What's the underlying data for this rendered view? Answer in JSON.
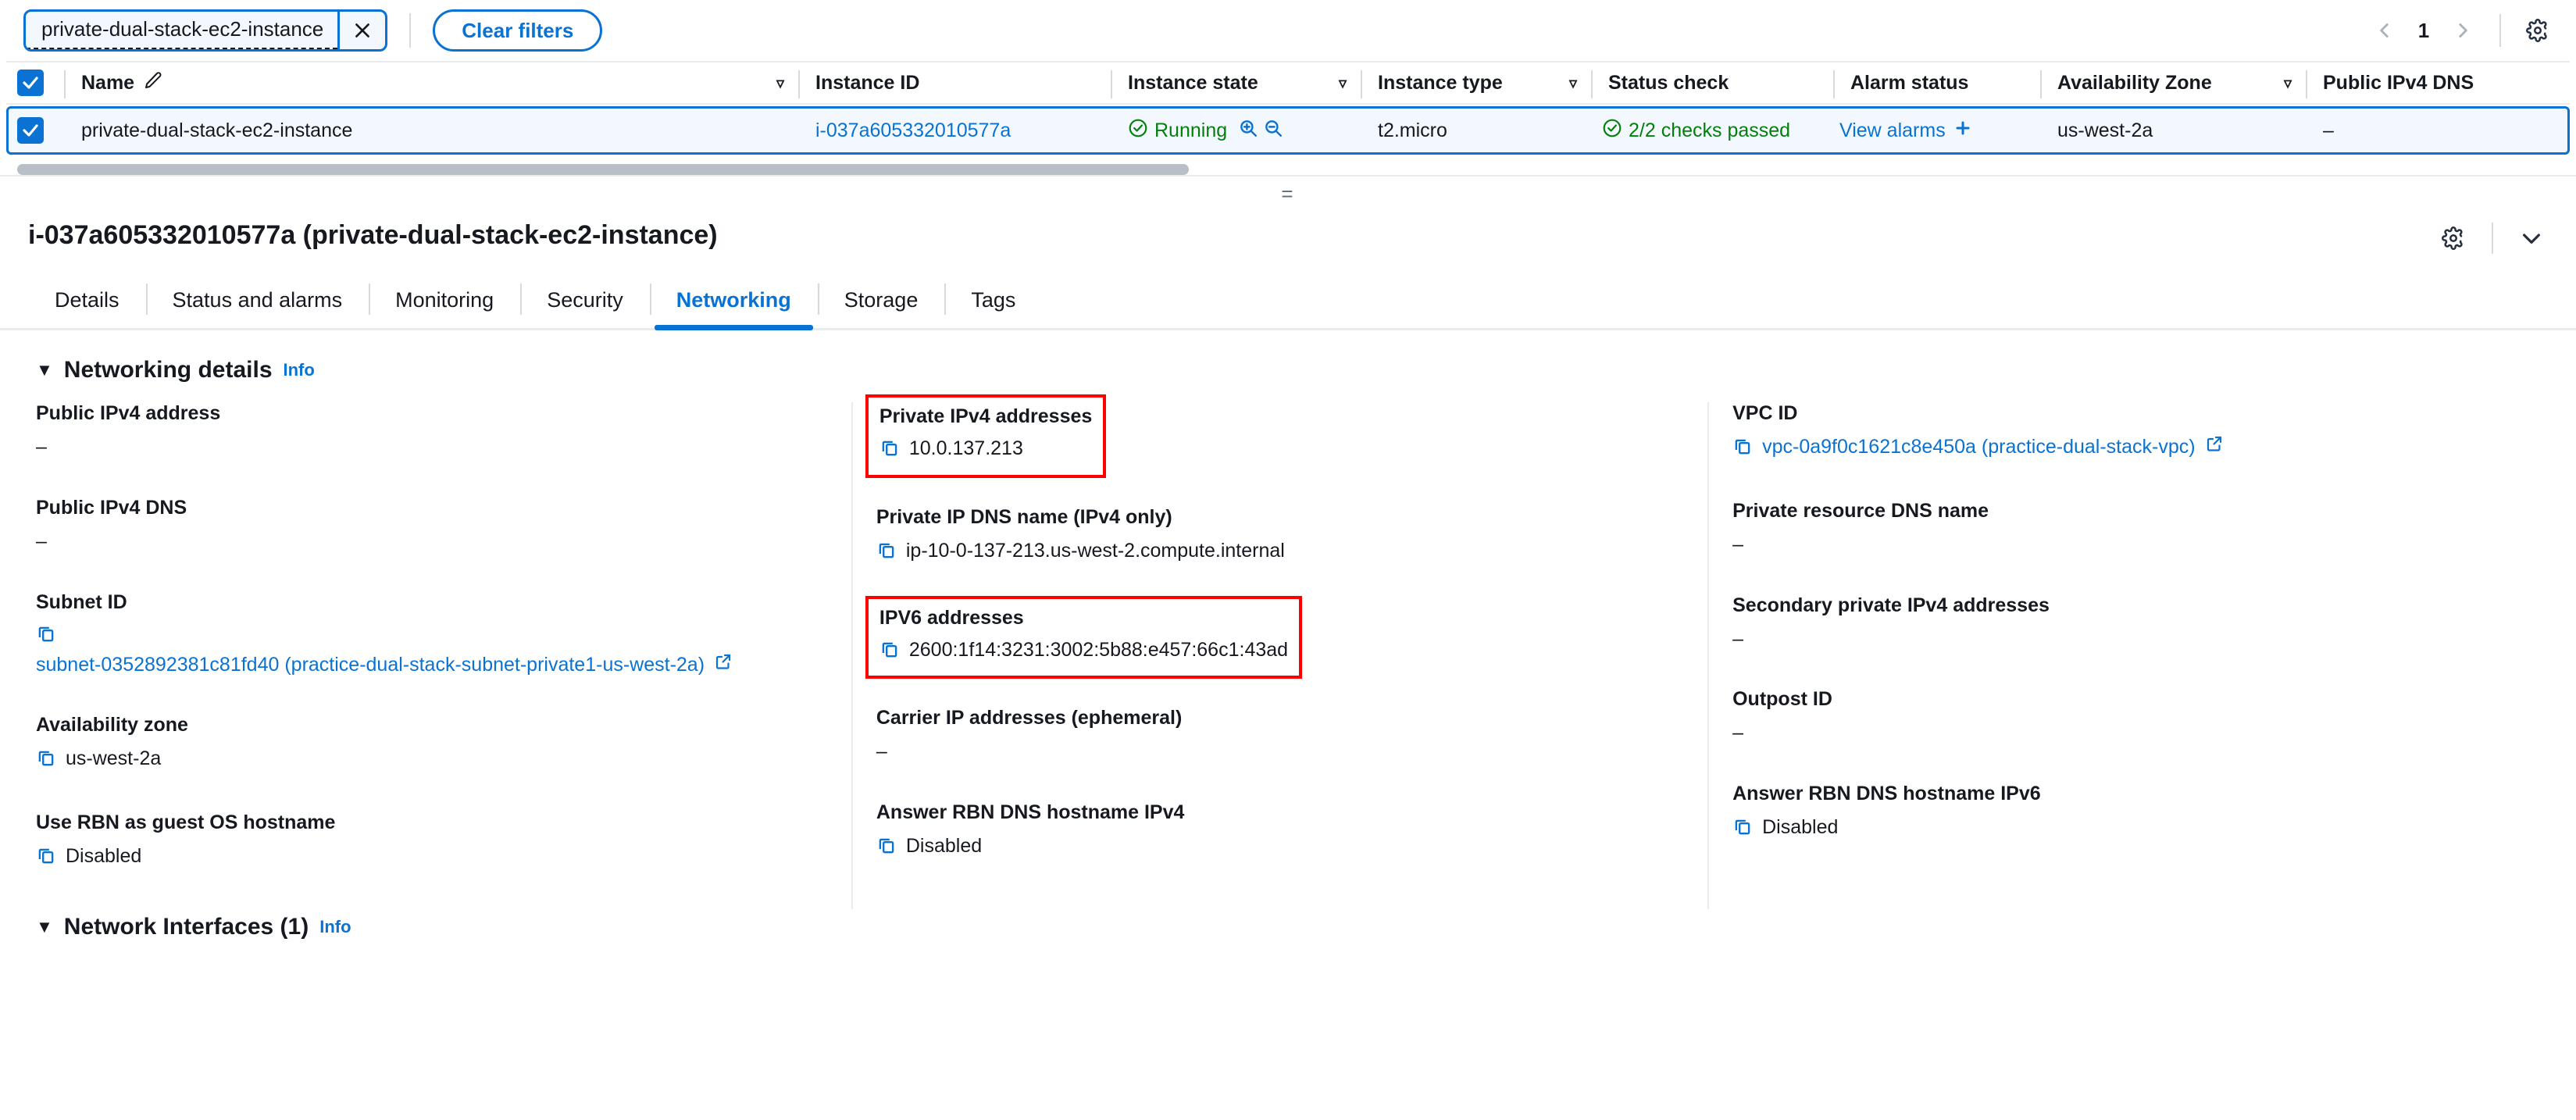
{
  "filter_bar": {
    "token_label": "private-dual-stack-ec2-instance",
    "token_remove_icon": "close-icon",
    "clear_filters_label": "Clear filters",
    "page_number": "1",
    "prev_icon": "chevron-left-icon",
    "next_icon": "chevron-right-icon",
    "settings_icon": "gear-icon"
  },
  "table": {
    "columns": [
      {
        "label": "Name",
        "has_edit_icon": true,
        "has_caret": true
      },
      {
        "label": "Instance ID",
        "has_caret": false
      },
      {
        "label": "Instance state",
        "has_caret": true
      },
      {
        "label": "Instance type",
        "has_caret": true
      },
      {
        "label": "Status check",
        "has_caret": false
      },
      {
        "label": "Alarm status",
        "has_caret": false
      },
      {
        "label": "Availability Zone",
        "has_caret": true
      },
      {
        "label": "Public IPv4 DNS",
        "has_caret": false
      }
    ],
    "rows": [
      {
        "selected": true,
        "name": "private-dual-stack-ec2-instance",
        "instance_id": "i-037a605332010577a",
        "instance_state": "Running",
        "instance_type": "t2.micro",
        "status_check": "2/2 checks passed",
        "alarm_status": "View alarms",
        "availability_zone": "us-west-2a",
        "public_ipv4_dns": "–"
      }
    ]
  },
  "detail": {
    "title": "i-037a605332010577a (private-dual-stack-ec2-instance)",
    "settings_icon": "gear-icon",
    "collapse_icon": "chevron-down-icon",
    "splitter_icon": "drag-handle-icon",
    "tabs": [
      {
        "label": "Details",
        "active": false
      },
      {
        "label": "Status and alarms",
        "active": false
      },
      {
        "label": "Monitoring",
        "active": false
      },
      {
        "label": "Security",
        "active": false
      },
      {
        "label": "Networking",
        "active": true
      },
      {
        "label": "Storage",
        "active": false
      },
      {
        "label": "Tags",
        "active": false
      }
    ],
    "networking_section": {
      "title": "Networking details",
      "info_label": "Info",
      "columns": [
        {
          "fields": [
            {
              "label": "Public IPv4 address",
              "value": "–",
              "copy": false,
              "highlight": false
            },
            {
              "label": "Public IPv4 DNS",
              "value": "–",
              "copy": false,
              "highlight": false
            },
            {
              "label": "Subnet ID",
              "value": "subnet-0352892381c81fd40 (practice-dual-stack-subnet-private1-us-west-2a)",
              "copy": true,
              "link": true,
              "external": true,
              "highlight": false
            },
            {
              "label": "Availability zone",
              "value": "us-west-2a",
              "copy": true,
              "highlight": false
            },
            {
              "label": "Use RBN as guest OS hostname",
              "value": "Disabled",
              "copy": true,
              "highlight": false
            }
          ]
        },
        {
          "fields": [
            {
              "label": "Private IPv4 addresses",
              "value": "10.0.137.213",
              "copy": true,
              "highlight": true
            },
            {
              "label": "Private IP DNS name (IPv4 only)",
              "value": "ip-10-0-137-213.us-west-2.compute.internal",
              "copy": true,
              "highlight": false
            },
            {
              "label": "IPV6 addresses",
              "value": "2600:1f14:3231:3002:5b88:e457:66c1:43ad",
              "copy": true,
              "highlight": true
            },
            {
              "label": "Carrier IP addresses (ephemeral)",
              "value": "–",
              "copy": false,
              "highlight": false
            },
            {
              "label": "Answer RBN DNS hostname IPv4",
              "value": "Disabled",
              "copy": true,
              "highlight": false
            }
          ]
        },
        {
          "fields": [
            {
              "label": "VPC ID",
              "value": "vpc-0a9f0c1621c8e450a (practice-dual-stack-vpc)",
              "copy": true,
              "link": true,
              "external": true,
              "highlight": false
            },
            {
              "label": "Private resource DNS name",
              "value": "–",
              "copy": false,
              "highlight": false
            },
            {
              "label": "Secondary private IPv4 addresses",
              "value": "–",
              "copy": false,
              "highlight": false
            },
            {
              "label": "Outpost ID",
              "value": "–",
              "copy": false,
              "highlight": false
            },
            {
              "label": "Answer RBN DNS hostname IPv6",
              "value": "Disabled",
              "copy": true,
              "highlight": false
            }
          ]
        }
      ]
    },
    "network_interfaces_section": {
      "title": "Network Interfaces (1)",
      "info_label": "Info"
    }
  },
  "colors": {
    "accent": "#0972d3",
    "success": "#037f0c",
    "highlight": "#ff0000",
    "row_selected_bg": "#f2f8fd"
  }
}
